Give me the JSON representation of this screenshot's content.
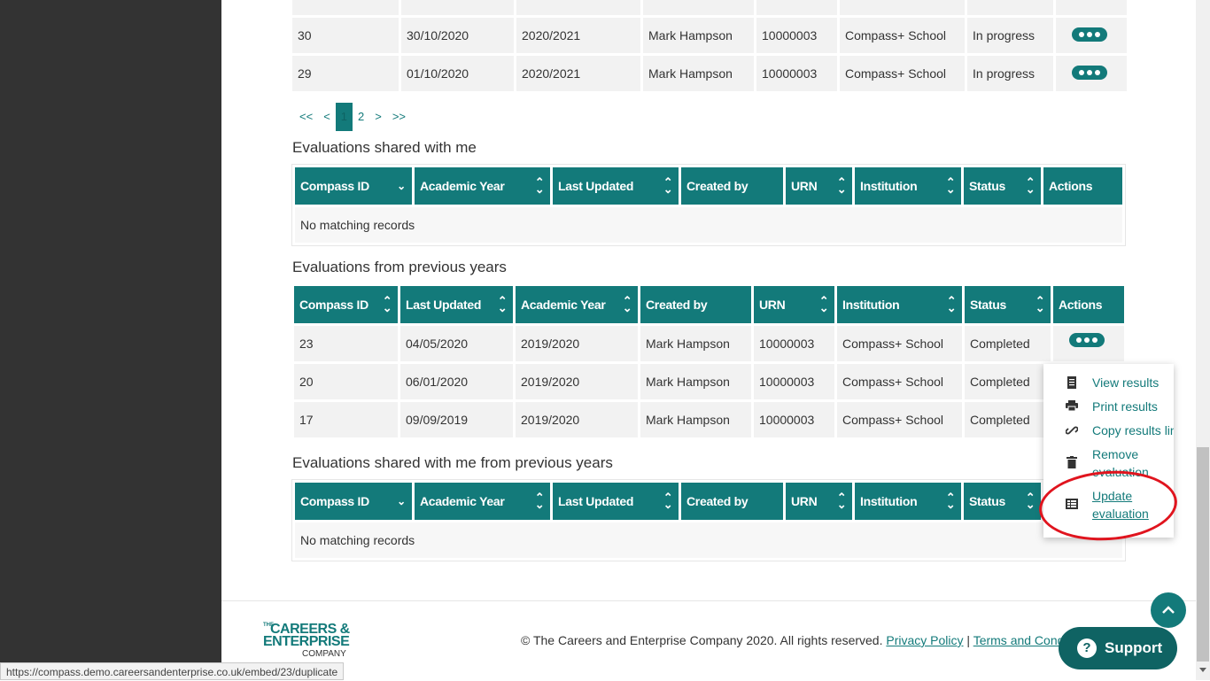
{
  "top_table": {
    "rows": [
      {
        "id": "30",
        "date": "30/10/2020",
        "year": "2020/2021",
        "creator": "Mark Hampson",
        "urn": "10000003",
        "institution": "Compass+ School",
        "status": "In progress"
      },
      {
        "id": "29",
        "date": "01/10/2020",
        "year": "2020/2021",
        "creator": "Mark Hampson",
        "urn": "10000003",
        "institution": "Compass+ School",
        "status": "In progress"
      }
    ]
  },
  "pagination": {
    "first": "<<",
    "prev": "<",
    "pages": [
      "1",
      "2"
    ],
    "next": ">",
    "last": ">>"
  },
  "shared": {
    "title": "Evaluations shared with me",
    "headers": [
      "Compass ID",
      "Academic Year",
      "Last Updated",
      "Created by",
      "URN",
      "Institution",
      "Status",
      "Actions"
    ],
    "empty": "No matching records"
  },
  "previous": {
    "title": "Evaluations from previous years",
    "headers": [
      "Compass ID",
      "Last Updated",
      "Academic Year",
      "Created by",
      "URN",
      "Institution",
      "Status",
      "Actions"
    ],
    "rows": [
      {
        "id": "23",
        "date": "04/05/2020",
        "year": "2019/2020",
        "creator": "Mark Hampson",
        "urn": "10000003",
        "institution": "Compass+ School",
        "status": "Completed"
      },
      {
        "id": "20",
        "date": "06/01/2020",
        "year": "2019/2020",
        "creator": "Mark Hampson",
        "urn": "10000003",
        "institution": "Compass+ School",
        "status": "Completed"
      },
      {
        "id": "17",
        "date": "09/09/2019",
        "year": "2019/2020",
        "creator": "Mark Hampson",
        "urn": "10000003",
        "institution": "Compass+ School",
        "status": "Completed"
      }
    ]
  },
  "shared_previous": {
    "title": "Evaluations shared with me from previous years",
    "headers": [
      "Compass ID",
      "Academic Year",
      "Last Updated",
      "Created by",
      "URN",
      "Institution",
      "Status"
    ],
    "empty": "No matching records"
  },
  "action_menu": {
    "items": [
      {
        "label": "View results",
        "icon": "document-icon"
      },
      {
        "label": "Print results",
        "icon": "printer-icon"
      },
      {
        "label": "Copy results link",
        "icon": "link-icon"
      },
      {
        "label": "Remove evaluation",
        "icon": "trash-icon"
      },
      {
        "label": "Update evaluation",
        "icon": "edit-list-icon"
      }
    ]
  },
  "footer": {
    "logo": {
      "the": "THE",
      "line1": "CAREERS &",
      "line2": "ENTERPRISE",
      "line3": "COMPANY"
    },
    "copyright": "© The Careers and Enterprise Company 2020. All rights reserved.",
    "privacy": "Privacy Policy",
    "separator": "|",
    "terms": "Terms and Conditions"
  },
  "support_label": "Support",
  "back_to_top_icon": "chevron-up-icon",
  "status_url": "https://compass.demo.careersandenterprise.co.uk/embed/23/duplicate",
  "colors": {
    "teal": "#137a7a",
    "dark_teal": "#0f6363",
    "sidebar": "#333333",
    "highlight": "#e0141e"
  }
}
